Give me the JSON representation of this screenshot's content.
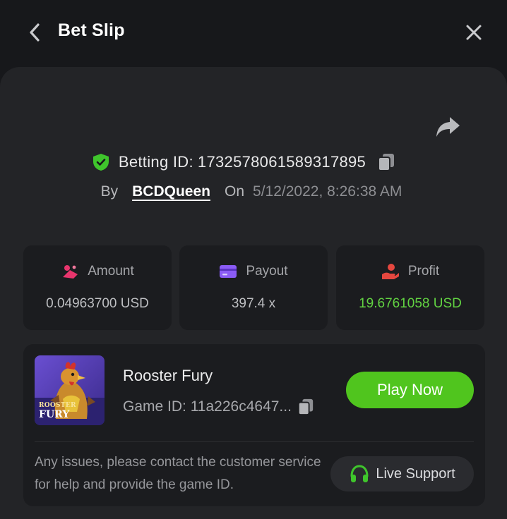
{
  "header": {
    "title": "Bet Slip",
    "back_icon": "chevron-left-icon",
    "close_icon": "close-icon"
  },
  "bet": {
    "id_label": "Betting ID:",
    "id_value": "1732578061589317895",
    "by_label": "By",
    "user": "BCDQueen",
    "on_label": "On",
    "datetime": "5/12/2022, 8:26:38 AM"
  },
  "stats": [
    {
      "label": "Amount",
      "value": "0.04963700 USD",
      "icon": "coins-icon"
    },
    {
      "label": "Payout",
      "value": "397.4 x",
      "icon": "card-icon"
    },
    {
      "label": "Profit",
      "value": "19.6761058 USD",
      "icon": "hand-coin-icon"
    }
  ],
  "game": {
    "name": "Rooster Fury",
    "id_label": "Game ID: 11a226c4647...",
    "thumb_line1": "ROOSTER",
    "thumb_line2": "FURY",
    "play_label": "Play Now"
  },
  "support": {
    "text": "Any issues, please contact the customer service for help and provide the game ID.",
    "button_label": "Live Support"
  },
  "colors": {
    "background": "#17181b",
    "panel": "#232427",
    "card": "#1b1c1f",
    "accent_green": "#50c51e",
    "profit_green": "#62d342",
    "shield_green": "#3fc52c",
    "amount_pink": "#e8356d",
    "payout_purple": "#8b5cf6",
    "profit_red": "#e5473f"
  }
}
